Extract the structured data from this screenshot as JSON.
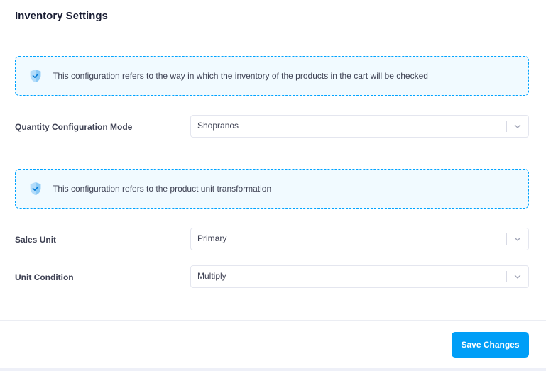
{
  "header": {
    "title": "Inventory Settings"
  },
  "notices": [
    {
      "icon": "shield-check-icon",
      "text": "This configuration refers to the way in which the inventory of the products in the cart will be checked"
    },
    {
      "icon": "shield-check-icon",
      "text": "This configuration refers to the product unit transformation"
    }
  ],
  "fields": {
    "quantity_mode": {
      "label": "Quantity Configuration Mode",
      "value": "Shopranos"
    },
    "sales_unit": {
      "label": "Sales Unit",
      "value": "Primary"
    },
    "unit_condition": {
      "label": "Unit Condition",
      "value": "Multiply"
    }
  },
  "footer": {
    "save_label": "Save Changes"
  },
  "colors": {
    "accent": "#009ef7",
    "notice_bg": "#f1faff",
    "notice_border": "#00a3ff"
  }
}
